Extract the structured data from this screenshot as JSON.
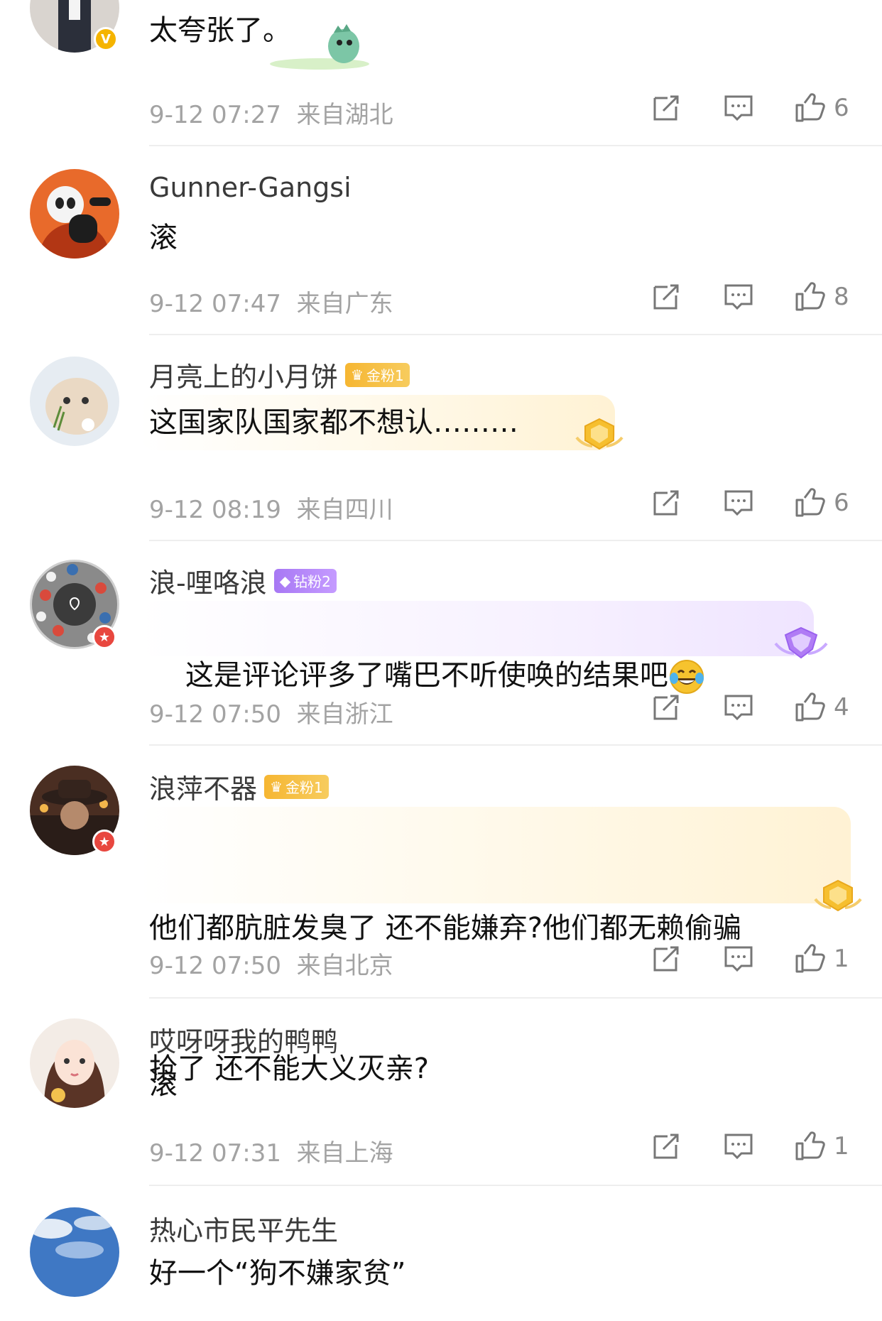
{
  "comments": [
    {
      "username": "",
      "content": "太夸张了。",
      "time": "9-12 07:27",
      "location": "来自湖北",
      "likes": "6",
      "avatar_badge": "V"
    },
    {
      "username": "Gunner-Gangsi",
      "content": "滚",
      "time": "9-12 07:47",
      "location": "来自广东",
      "likes": "8"
    },
    {
      "username": "月亮上的小月饼",
      "fan_badge": "金粉1",
      "content": "这国家队国家都不想认………",
      "time": "9-12 08:19",
      "location": "来自四川",
      "likes": "6"
    },
    {
      "username": "浪-哩咯浪",
      "fan_badge": "钻粉2",
      "content": "这是评论评多了嘴巴不听使唤的结果吧",
      "time": "9-12 07:50",
      "location": "来自浙江",
      "likes": "4"
    },
    {
      "username": "浪萍不器",
      "fan_badge": "金粉1",
      "content_line1": "他们都肮脏发臭了 还不能嫌弃?他们都无赖偷骗",
      "content_line2": "抢了 还不能大义灭亲?",
      "time": "9-12 07:50",
      "location": "来自北京",
      "likes": "1"
    },
    {
      "username": "哎呀呀我的鸭鸭",
      "content": "滚",
      "time": "9-12 07:31",
      "location": "来自上海",
      "likes": "1"
    },
    {
      "username": "热心市民平先生",
      "content": "好一个“狗不嫌家贫”"
    }
  ],
  "icons": {
    "share": "share-icon",
    "comment": "comment-icon",
    "like": "thumbs-up-icon",
    "laugh": "laughing-tears-emoji"
  },
  "colors": {
    "meta_text": "#a3a3a3",
    "gold_badge": "#f6b632",
    "diamond_badge": "#a778f4"
  }
}
